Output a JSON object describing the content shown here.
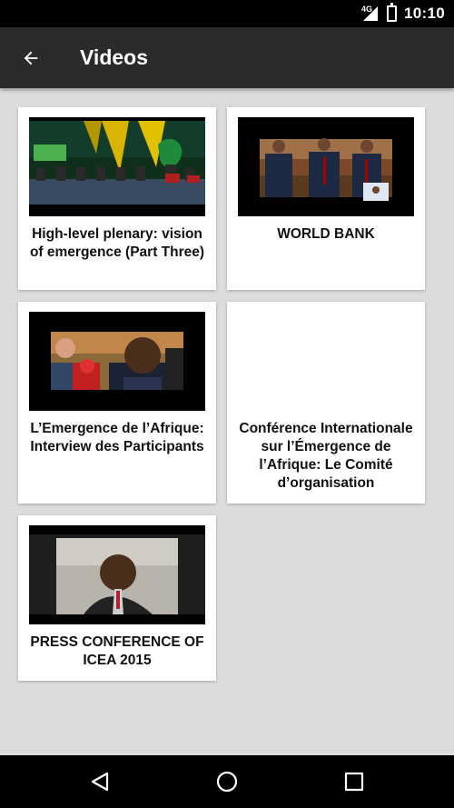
{
  "status_bar": {
    "network": "4G",
    "time": "10:10"
  },
  "app_bar": {
    "title": "Videos"
  },
  "videos": [
    {
      "title": "High-level plenary: vision of emergence (Part Three)"
    },
    {
      "title": "WORLD BANK"
    },
    {
      "title": "L’Emergence de l’Afrique: Interview des Participants"
    },
    {
      "title": "Conférence Internationale sur l’Émergence de l’Afrique: Le Comité d’organisation"
    },
    {
      "title": "PRESS CONFERENCE OF ICEA 2015"
    }
  ],
  "icons": {
    "back": "arrow-back-icon",
    "nav_back": "triangle-back-icon",
    "nav_home": "circle-home-icon",
    "nav_recents": "square-recents-icon"
  }
}
